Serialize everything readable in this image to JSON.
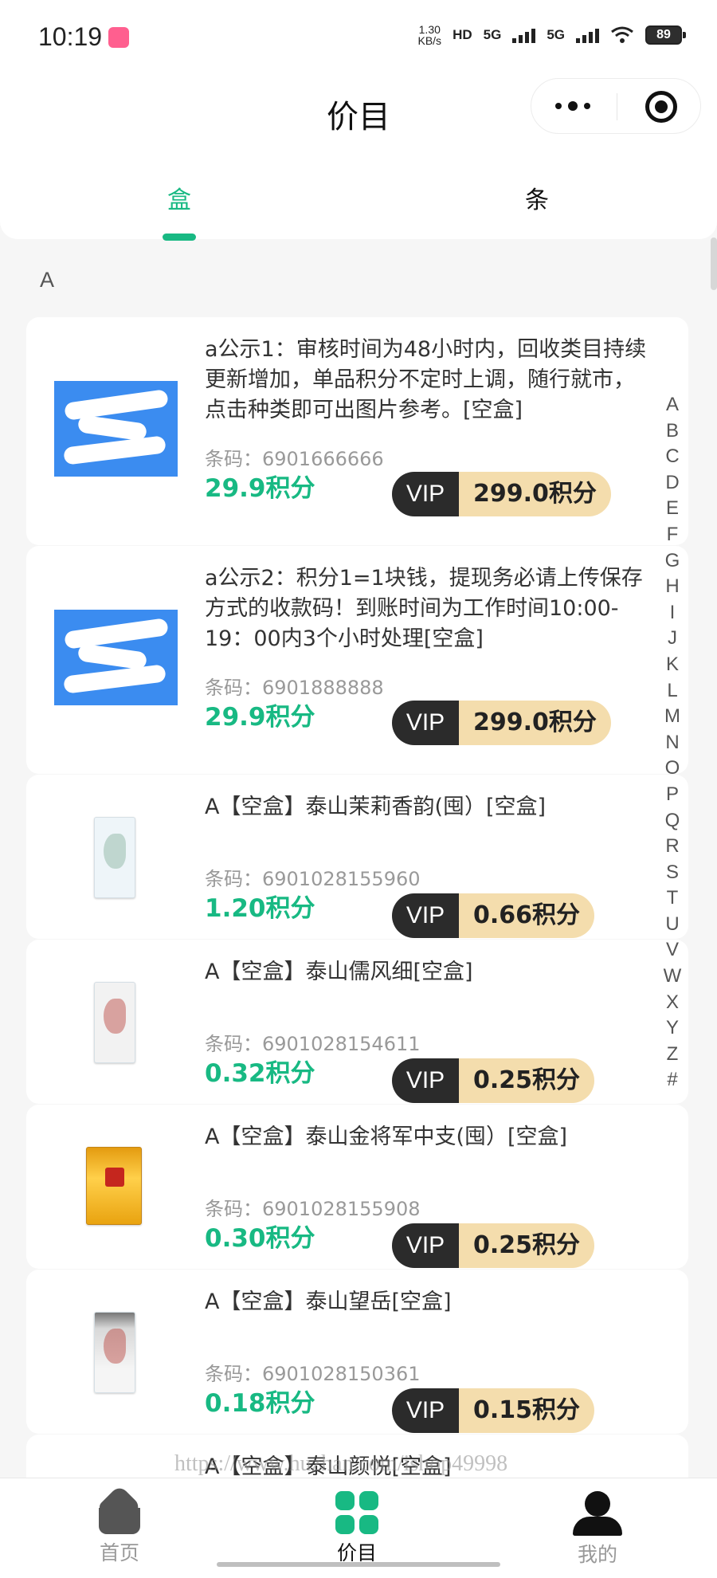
{
  "status_bar": {
    "time": "10:19",
    "speed_value": "1.30",
    "speed_unit": "KB/s",
    "network_hd": "HD",
    "network_5g_1": "5G",
    "network_5g_2": "5G",
    "battery": "89",
    "icons": [
      "app-notification-icon",
      "signal-icon",
      "wifi-icon",
      "battery-icon"
    ]
  },
  "nav": {
    "title": "价目",
    "capsule_icons": [
      "more-icon",
      "close-target-icon"
    ]
  },
  "tabs": [
    {
      "label": "盒",
      "active": true
    },
    {
      "label": "条",
      "active": false
    }
  ],
  "section": {
    "letter": "A"
  },
  "items": [
    {
      "title": "a公示1：审核时间为48小时内，回收类目持续更新增加，单品积分不定时上调，随行就市，点击种类即可出图片参考。[空盒]",
      "barcode": "条码：6901666666",
      "price_value": "29.9",
      "price_unit": "积分",
      "vip_label": "VIP",
      "vip_value": "299.0",
      "vip_unit": "积分",
      "image_icon": "notice-image"
    },
    {
      "title": "a公示2：积分1=1块钱，提现务必请上传保存方式的收款码！到账时间为工作时间10:00-19：00内3个小时处理[空盒]",
      "barcode": "条码：6901888888",
      "price_value": "29.9",
      "price_unit": "积分",
      "vip_label": "VIP",
      "vip_value": "299.0",
      "vip_unit": "积分",
      "image_icon": "notice-image"
    },
    {
      "title": "A【空盒】泰山茉莉香韵(囤）[空盒]",
      "barcode": "条码：6901028155960",
      "price_value": "1.20",
      "price_unit": "积分",
      "vip_label": "VIP",
      "vip_value": "0.66",
      "vip_unit": "积分",
      "image_icon": "cigarette-pack-image"
    },
    {
      "title": "A【空盒】泰山儒风细[空盒]",
      "barcode": "条码：6901028154611",
      "price_value": "0.32",
      "price_unit": "积分",
      "vip_label": "VIP",
      "vip_value": "0.25",
      "vip_unit": "积分",
      "image_icon": "cigarette-pack-image"
    },
    {
      "title": "A【空盒】泰山金将军中支(囤）[空盒]",
      "barcode": "条码：6901028155908",
      "price_value": "0.30",
      "price_unit": "积分",
      "vip_label": "VIP",
      "vip_value": "0.25",
      "vip_unit": "积分",
      "image_icon": "cigarette-pack-image"
    },
    {
      "title": "A【空盒】泰山望岳[空盒]",
      "barcode": "条码：6901028150361",
      "price_value": "0.18",
      "price_unit": "积分",
      "vip_label": "VIP",
      "vip_value": "0.15",
      "vip_unit": "积分",
      "image_icon": "cigarette-pack-image"
    }
  ],
  "peek_item": {
    "title": "A【空盒】泰山颜悦[空盒]"
  },
  "alphabet": [
    "A",
    "B",
    "C",
    "D",
    "E",
    "F",
    "G",
    "H",
    "I",
    "J",
    "K",
    "L",
    "M",
    "N",
    "O",
    "P",
    "Q",
    "R",
    "S",
    "T",
    "U",
    "V",
    "W",
    "X",
    "Y",
    "Z",
    "#"
  ],
  "watermark": "https://www.huzhan.com/ishop49998",
  "bottom_nav": [
    {
      "label": "首页",
      "icon": "home-icon",
      "active": false
    },
    {
      "label": "价目",
      "icon": "grid-icon",
      "active": true
    },
    {
      "label": "我的",
      "icon": "user-icon",
      "active": false
    }
  ],
  "colors": {
    "accent": "#18b983",
    "vip_dark": "#2b2b2b",
    "vip_gold": "#f4ddad",
    "notice_blue": "#3b8cf0"
  }
}
